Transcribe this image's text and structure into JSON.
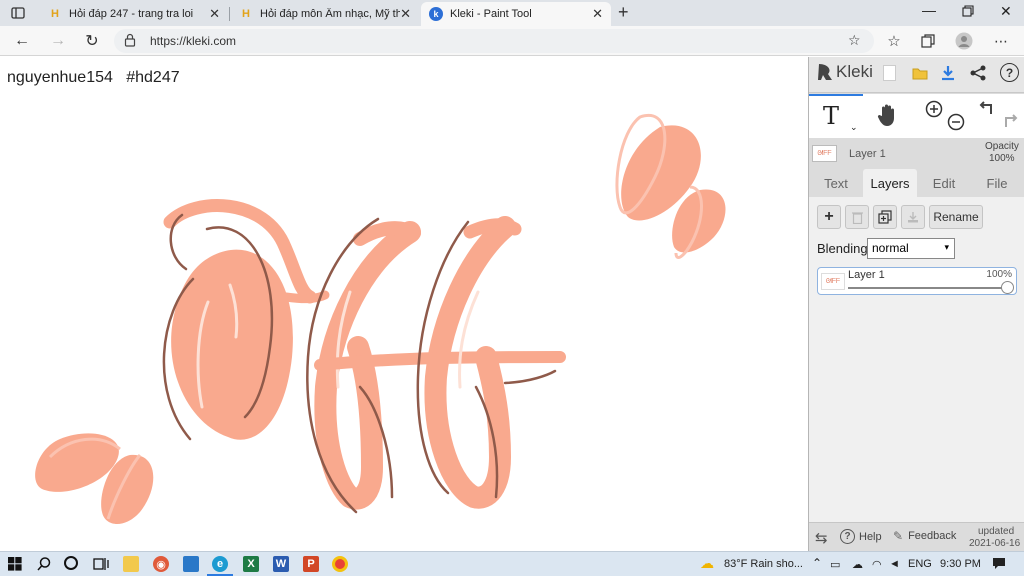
{
  "browser": {
    "tabs": [
      {
        "label": "Hỏi đáp 247 - trang tra loi",
        "icon": "h-logo-icon",
        "active": false
      },
      {
        "label": "Hỏi đáp môn Âm nhạc, Mỹ thuật",
        "icon": "h-logo-icon",
        "active": false
      },
      {
        "label": "Kleki - Paint Tool",
        "icon": "kleki-logo-icon",
        "active": true
      }
    ],
    "url": "https://kleki.com",
    "window_controls": [
      "minimize-icon",
      "maximize-icon",
      "close-icon"
    ]
  },
  "canvas": {
    "watermark": "nguyenhue154   #hd247",
    "colors": {
      "fill": "#f9a98e",
      "outline": "#8f5a4a",
      "highlight": "#fde1d6"
    }
  },
  "panel": {
    "brand": "Kleki",
    "opacity_label": "Opacity",
    "opacity_value": "100%",
    "current_layer": "Layer 1",
    "tabs": [
      "Text",
      "Layers",
      "Edit",
      "File"
    ],
    "active_tab": "Layers",
    "rename_label": "Rename",
    "blending_label": "Blending",
    "blending_value": "normal",
    "layers": [
      {
        "name": "Layer 1",
        "opacity": "100%"
      }
    ],
    "footer": {
      "help": "Help",
      "feedback": "Feedback",
      "updated_label": "updated",
      "updated_date": "2021-06-16"
    },
    "accent": "#2d7be0"
  },
  "taskbar": {
    "weather": "83°F  Rain sho...",
    "language": "ENG",
    "time": "9:30 PM"
  }
}
